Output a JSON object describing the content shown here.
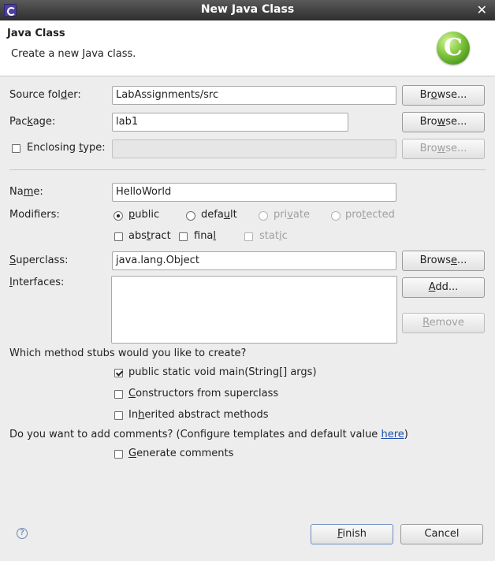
{
  "window": {
    "title": "New Java Class",
    "close_glyph": "✕"
  },
  "banner": {
    "heading": "Java Class",
    "description": "Create a new Java class.",
    "logo_letter": "C"
  },
  "form": {
    "source_folder": {
      "label_pre": "Source fol",
      "label_u": "d",
      "label_post": "er:",
      "value": "LabAssignments/src"
    },
    "package": {
      "label_pre": "Pac",
      "label_u": "k",
      "label_post": "age:",
      "value": "lab1"
    },
    "enclosing": {
      "label_pre": "Enclosing ",
      "label_u": "t",
      "label_post": "ype:",
      "value": ""
    },
    "name": {
      "label_pre": "Na",
      "label_u": "m",
      "label_post": "e:",
      "value": "HelloWorld"
    },
    "modifiers": {
      "label": "Modifiers:",
      "public": {
        "pre": "",
        "u": "p",
        "post": "ublic"
      },
      "default": {
        "pre": "defa",
        "u": "u",
        "post": "lt"
      },
      "private": {
        "pre": "pri",
        "u": "v",
        "post": "ate"
      },
      "protected": {
        "pre": "pro",
        "u": "t",
        "post": "ected"
      },
      "abstract": {
        "pre": "abs",
        "u": "t",
        "post": "ract"
      },
      "final": {
        "pre": "fina",
        "u": "l",
        "post": ""
      },
      "static": {
        "pre": "stat",
        "u": "i",
        "post": "c"
      }
    },
    "superclass": {
      "label_pre": "",
      "label_u": "S",
      "label_post": "uperclass:",
      "value": "java.lang.Object"
    },
    "interfaces": {
      "label_pre": "",
      "label_u": "I",
      "label_post": "nterfaces:"
    },
    "buttons": {
      "browse_source": {
        "pre": "Br",
        "u": "o",
        "post": "wse..."
      },
      "browse_package": {
        "pre": "Bro",
        "u": "w",
        "post": "se..."
      },
      "browse_enclosing": {
        "pre": "Bro",
        "u": "w",
        "post": "se..."
      },
      "browse_superclass": {
        "pre": "Brows",
        "u": "e",
        "post": "..."
      },
      "add": {
        "pre": "",
        "u": "A",
        "post": "dd..."
      },
      "remove": {
        "pre": "",
        "u": "R",
        "post": "emove"
      }
    },
    "stubs": {
      "question": "Which method stubs would you like to create?",
      "main": "public static void main(String[] args)",
      "constructors": {
        "pre": "",
        "u": "C",
        "post": "onstructors from superclass"
      },
      "inherited": {
        "pre": "In",
        "u": "h",
        "post": "erited abstract methods"
      }
    },
    "comments": {
      "question": "Do you want to add comments? (Configure templates and default value ",
      "link": "here",
      "close_paren": ")",
      "generate": {
        "pre": "",
        "u": "G",
        "post": "enerate comments"
      }
    }
  },
  "footer": {
    "help_glyph": "?",
    "finish": {
      "pre": "",
      "u": "F",
      "post": "inish"
    },
    "cancel": "Cancel"
  }
}
